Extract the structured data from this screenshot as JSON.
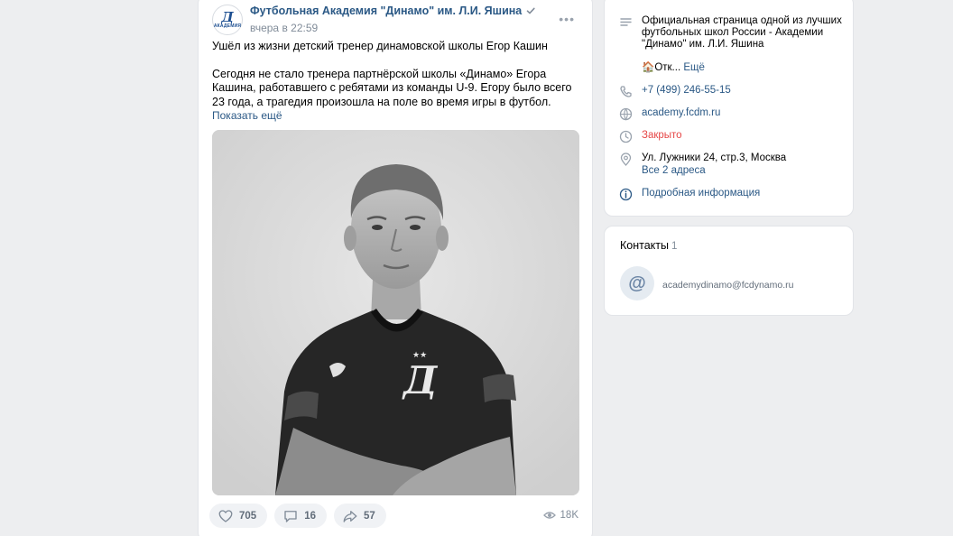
{
  "post": {
    "author": "Футбольная Академия \"Динамо\" им. Л.И. Яшина",
    "avatar_text": "АКАДЕМИЯ",
    "avatar_letter": "Д",
    "time": "вчера в 22:59",
    "more_label": "•••",
    "paragraph1": "Ушёл из жизни детский тренер динамовской школы Егор Кашин",
    "paragraph2": "Сегодня не стало тренера партнёрской школы «Динамо» Егора Кашина, работавшего с ребятами из команды U-9. Егору было всего 23 года, а трагедия произошла на поле во время игры в футбол.",
    "show_more": "Показать ещё",
    "photo_alt": "Фото тренера",
    "likes": "705",
    "comments": "16",
    "shares": "57",
    "views": "18K"
  },
  "info": {
    "description": "Официальная страница одной из лучших футбольных школ России - Академии \"Динамо\" им. Л.И. Яшина",
    "house_line": "🏠Отк...",
    "more_link": "Ещё",
    "phone": "+7 (499) 246-55-15",
    "website": "academy.fcdm.ru",
    "status": "Закрыто",
    "address": "Ул. Лужники 24, стр.3, Москва",
    "all_addresses": "Все 2 адреса",
    "details": "Подробная информация"
  },
  "contacts": {
    "title": "Контакты",
    "count": "1",
    "email": "academydinamo@fcdynamo.ru",
    "avatar_symbol": "@"
  },
  "colors": {
    "background": "#edeef0",
    "link": "#2a5885",
    "closed": "#e64646",
    "muted": "#818c99"
  }
}
